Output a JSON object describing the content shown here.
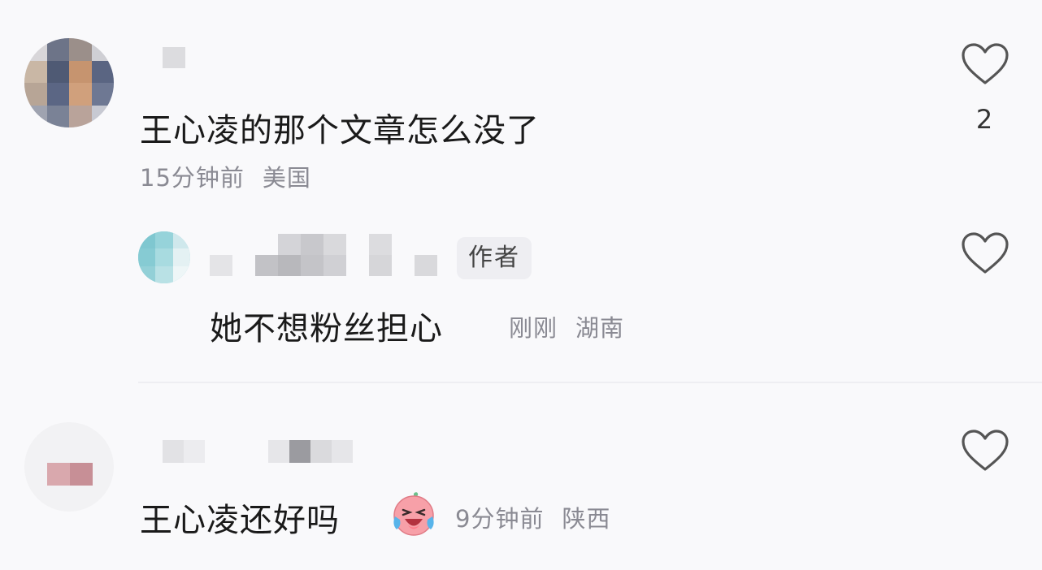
{
  "comments": [
    {
      "text": "王心凌的那个文章怎么没了",
      "time": "15分钟前",
      "location": "美国",
      "likes": "2"
    },
    {
      "badge": "作者",
      "text": "她不想粉丝担心",
      "time": "刚刚",
      "location": "湖南"
    },
    {
      "text": "王心凌还好吗",
      "time": "9分钟前",
      "location": "陕西",
      "emoji": "crying-laughing-face-icon"
    }
  ],
  "colors": {
    "background": "#f9f9fb",
    "meta_text": "#8a8a93",
    "heart_outline": "#555555"
  }
}
